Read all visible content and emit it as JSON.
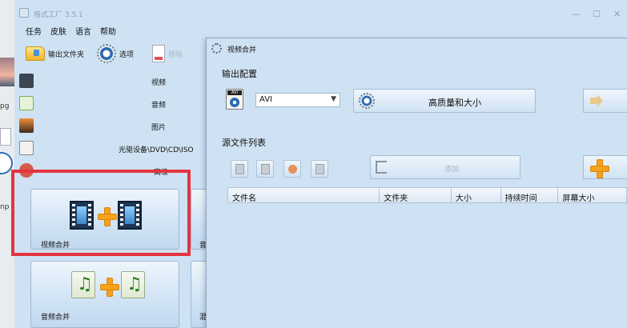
{
  "desktop": {
    "file_labels": [
      "pg",
      "np"
    ]
  },
  "app": {
    "title": "格式工厂 3.5.1",
    "menu": [
      "任务",
      "皮肤",
      "语言",
      "帮助"
    ],
    "toolbar": {
      "output_folder": "输出文件夹",
      "options": "选项",
      "remove_partial": "移除"
    },
    "categories": [
      "视频",
      "音频",
      "图片",
      "光驱设备\\DVD\\CD\\ISO",
      "高级"
    ],
    "tiles": {
      "video_merge": "视频合并",
      "audio_merge": "音频合并",
      "partial_right_top": "音",
      "partial_right_bottom": "混"
    },
    "window_controls": {
      "minimize": "—",
      "maximize": "☐",
      "close": "✕"
    }
  },
  "dialog": {
    "title": "视频合并",
    "output_config_label": "输出配置",
    "format_value": "AVI",
    "format_icon_text": "AVI",
    "quality_button": "高质量和大小",
    "source_list_label": "源文件列表",
    "add_file_button": "添加",
    "columns": [
      "文件名",
      "文件夹",
      "大小",
      "持续时间",
      "屏幕大小"
    ]
  },
  "colors": {
    "highlight": "#e3343f",
    "accent_orange": "#f6a21a",
    "window_bg": "#cfe2f3"
  }
}
